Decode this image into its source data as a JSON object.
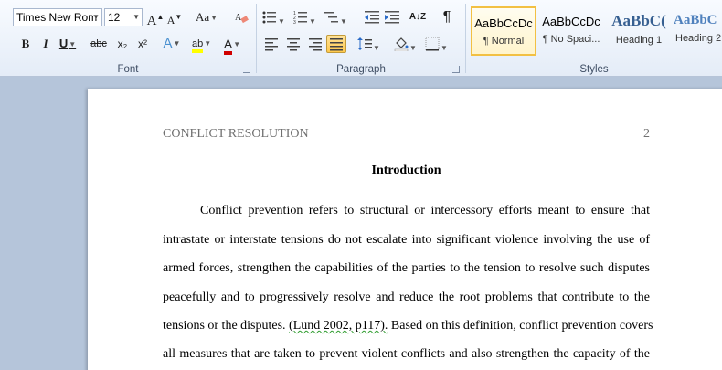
{
  "ribbon": {
    "font_group": {
      "label": "Font",
      "font_name": "Times New Rom",
      "font_size": "12",
      "grow_font": "A",
      "shrink_font": "A",
      "change_case": "Aa",
      "bold": "B",
      "italic": "I",
      "underline": "U",
      "strikethrough": "abc",
      "subscript": "x₂",
      "superscript": "x²",
      "text_effects": "A",
      "highlight": "ab",
      "font_color": "A"
    },
    "paragraph_group": {
      "label": "Paragraph",
      "sort": "A↓Z",
      "show_marks": "¶"
    },
    "styles_group": {
      "label": "Styles",
      "tiles": [
        {
          "preview": "AaBbCcDc",
          "name": "¶ Normal"
        },
        {
          "preview": "AaBbCcDc",
          "name": "¶ No Spaci..."
        },
        {
          "preview": "AaBbC(",
          "name": "Heading 1"
        },
        {
          "preview": "AaBbC",
          "name": "Heading 2"
        }
      ]
    },
    "colors": {
      "highlight": "#ffff00",
      "font_color": "#d00000",
      "accent": "#f2c043"
    }
  },
  "document": {
    "header": "CONFLICT RESOLUTION",
    "page_number": "2",
    "heading": "Introduction",
    "lines": [
      "Conflict prevention refers to structural or intercessory efforts meant to ensure that",
      "intrastate or interstate tensions do not escalate into significant violence involving the use of",
      "armed forces, strengthen the capabilities of the parties to the tension to resolve such disputes",
      "peacefully and to progressively resolve and reduce the root problems that contribute to the",
      "tensions or the disputes.",
      "all measures that are taken to prevent violent conflicts and also strengthen the capacity of the"
    ],
    "citation": "(Lund 2002, p117).",
    "line5_tail": "Based on this definition, conflict prevention covers"
  }
}
